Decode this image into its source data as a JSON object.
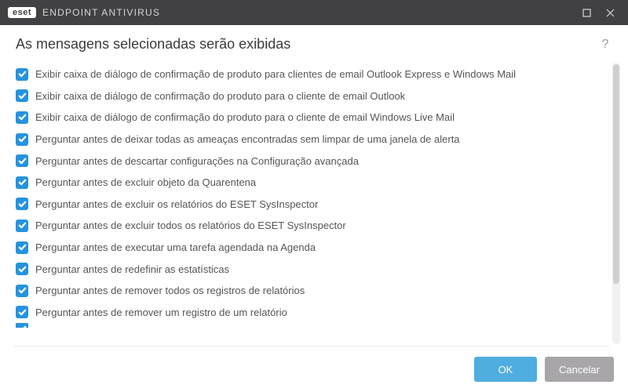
{
  "titlebar": {
    "brand_badge": "eset",
    "brand_text": "ENDPOINT ANTIVIRUS"
  },
  "header": {
    "title": "As mensagens selecionadas serão exibidas",
    "help": "?"
  },
  "items": [
    {
      "checked": true,
      "label": "Exibir caixa de diálogo de confirmação de produto para clientes de email Outlook Express e Windows Mail"
    },
    {
      "checked": true,
      "label": "Exibir caixa de diálogo de confirmação do produto para o cliente de email Outlook"
    },
    {
      "checked": true,
      "label": "Exibir caixa de diálogo de confirmação do produto para o cliente de email Windows Live Mail"
    },
    {
      "checked": true,
      "label": "Perguntar antes de deixar todas as ameaças encontradas sem limpar de uma janela de alerta"
    },
    {
      "checked": true,
      "label": "Perguntar antes de descartar configurações na Configuração avançada"
    },
    {
      "checked": true,
      "label": "Perguntar antes de excluir objeto da Quarentena"
    },
    {
      "checked": true,
      "label": "Perguntar antes de excluir os relatórios do ESET SysInspector"
    },
    {
      "checked": true,
      "label": "Perguntar antes de excluir todos os relatórios do ESET SysInspector"
    },
    {
      "checked": true,
      "label": "Perguntar antes de executar uma tarefa agendada na Agenda"
    },
    {
      "checked": true,
      "label": "Perguntar antes de redefinir as estatísticas"
    },
    {
      "checked": true,
      "label": "Perguntar antes de remover todos os registros de relatórios"
    },
    {
      "checked": true,
      "label": "Perguntar antes de remover um registro de um relatório"
    }
  ],
  "footer": {
    "ok": "OK",
    "cancel": "Cancelar"
  }
}
